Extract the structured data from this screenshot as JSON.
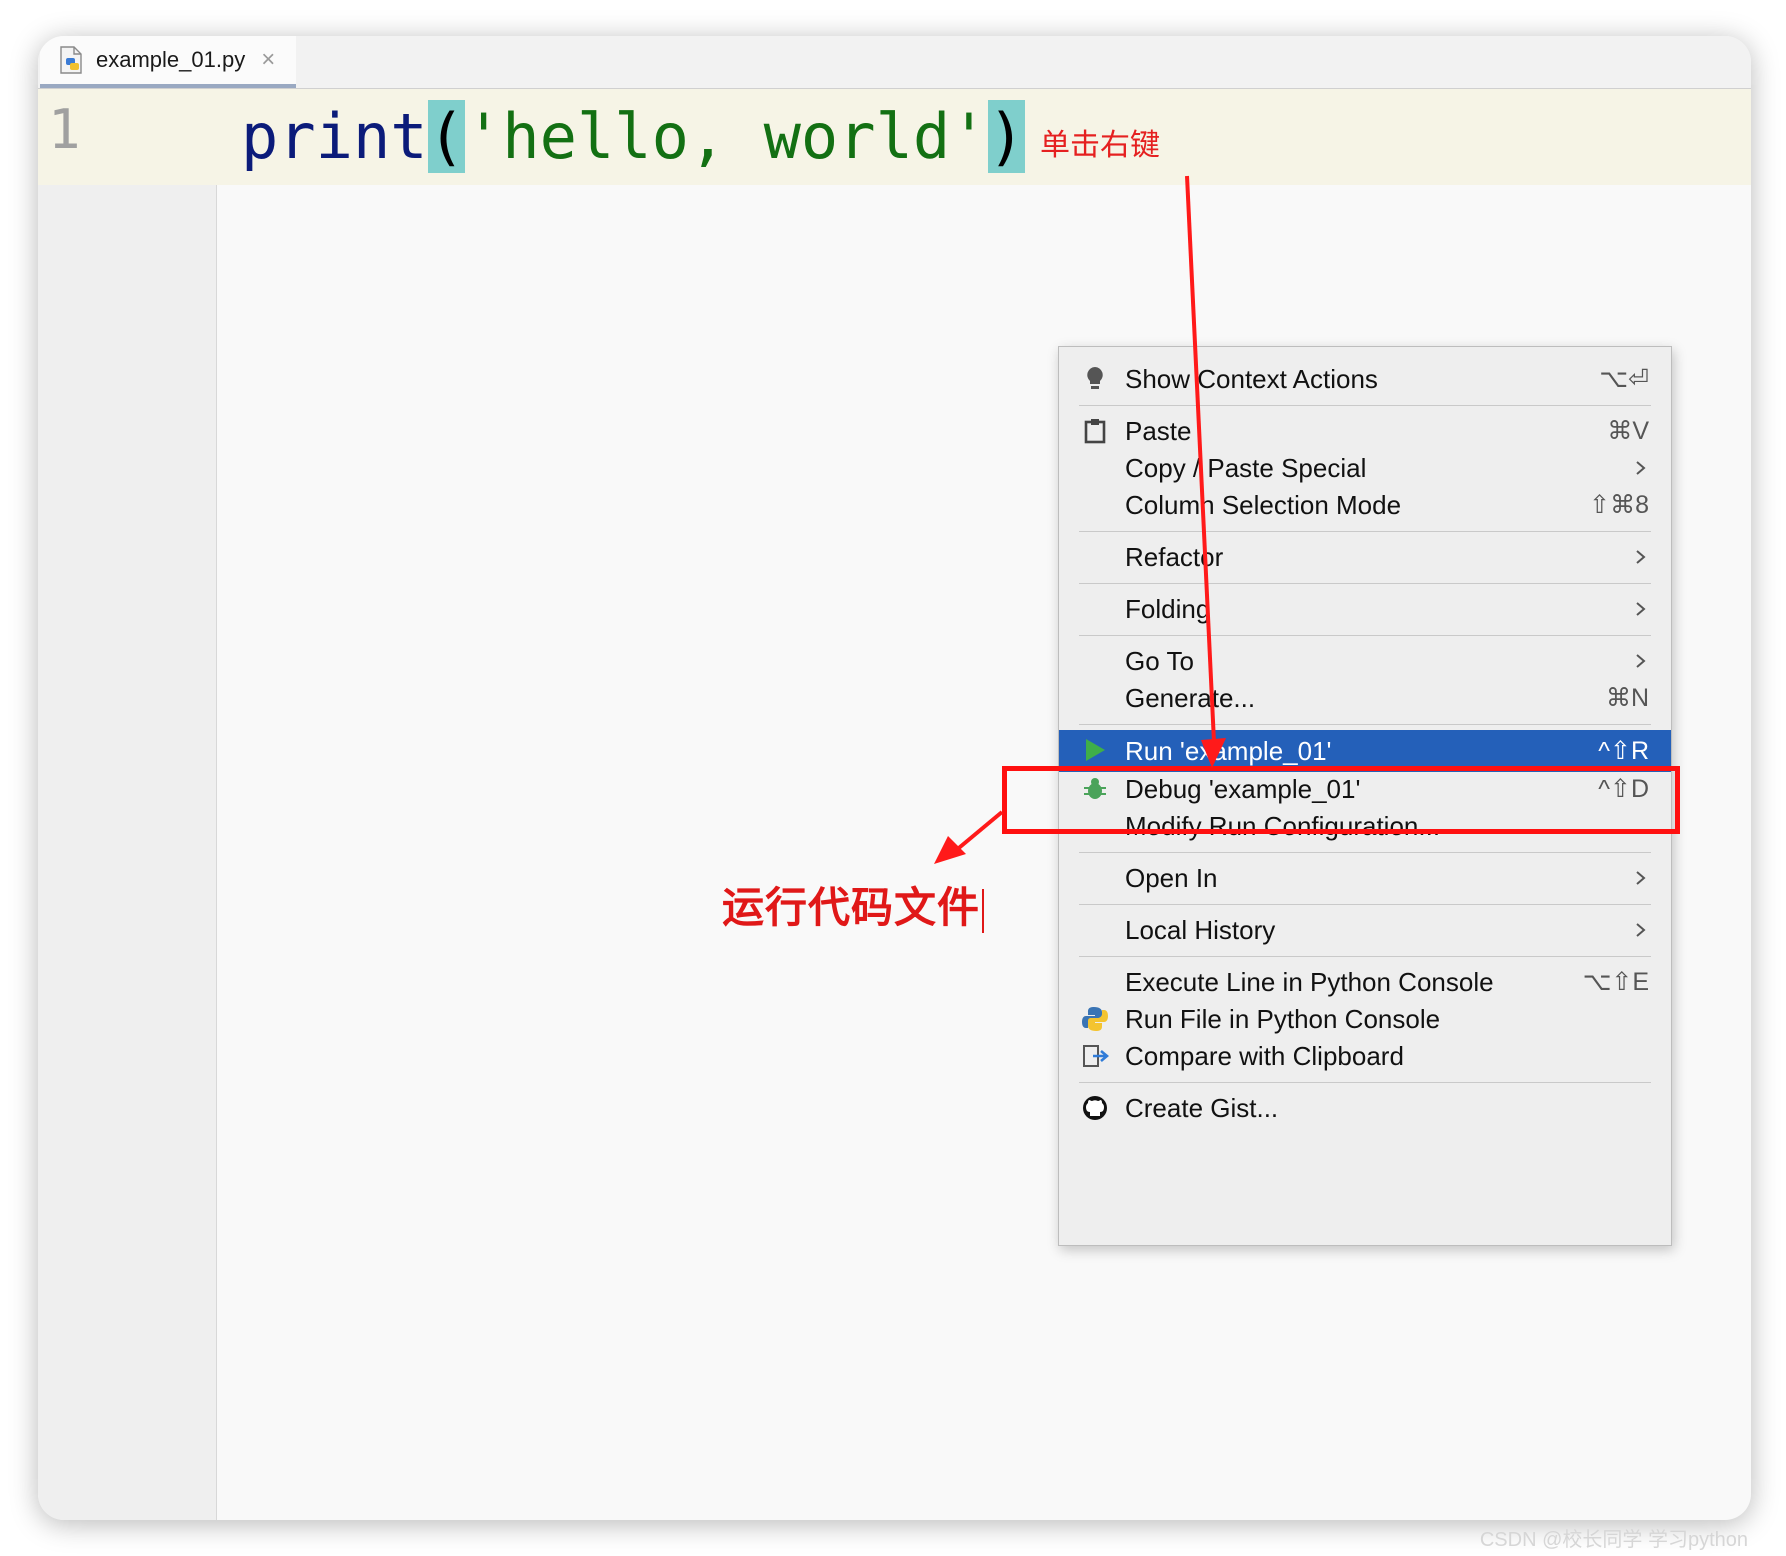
{
  "tab": {
    "filename": "example_01.py"
  },
  "editor": {
    "line_number": "1",
    "code": {
      "func": "print",
      "open": "(",
      "string": "'hello, world'",
      "close": ")"
    }
  },
  "annotations": {
    "right_click": "单击右键",
    "run_file": "运行代码文件"
  },
  "menu": {
    "items": [
      {
        "label": "Show Context Actions",
        "shortcut": "⌥⏎",
        "icon": "lightbulb-icon"
      },
      {
        "label": "Paste",
        "shortcut": "⌘V",
        "icon": "clipboard-icon"
      },
      {
        "label": "Copy / Paste Special",
        "submenu": true
      },
      {
        "label": "Column Selection Mode",
        "shortcut": "⇧⌘8"
      },
      {
        "label": "Refactor",
        "submenu": true
      },
      {
        "label": "Folding",
        "submenu": true
      },
      {
        "label": "Go To",
        "submenu": true
      },
      {
        "label": "Generate...",
        "shortcut": "⌘N"
      },
      {
        "label": "Run 'example_01'",
        "shortcut": "^⇧R",
        "icon": "run-icon",
        "selected": true
      },
      {
        "label": "Debug 'example_01'",
        "shortcut": "^⇧D",
        "icon": "debug-icon"
      },
      {
        "label": "Modify Run Configuration..."
      },
      {
        "label": "Open In",
        "submenu": true
      },
      {
        "label": "Local History",
        "submenu": true
      },
      {
        "label": "Execute Line in Python Console",
        "shortcut": "⌥⇧E"
      },
      {
        "label": "Run File in Python Console",
        "icon": "python-icon"
      },
      {
        "label": "Compare with Clipboard",
        "icon": "compare-icon"
      },
      {
        "label": "Create Gist...",
        "icon": "github-icon"
      }
    ]
  },
  "watermark": "CSDN @校长同学 学习python"
}
